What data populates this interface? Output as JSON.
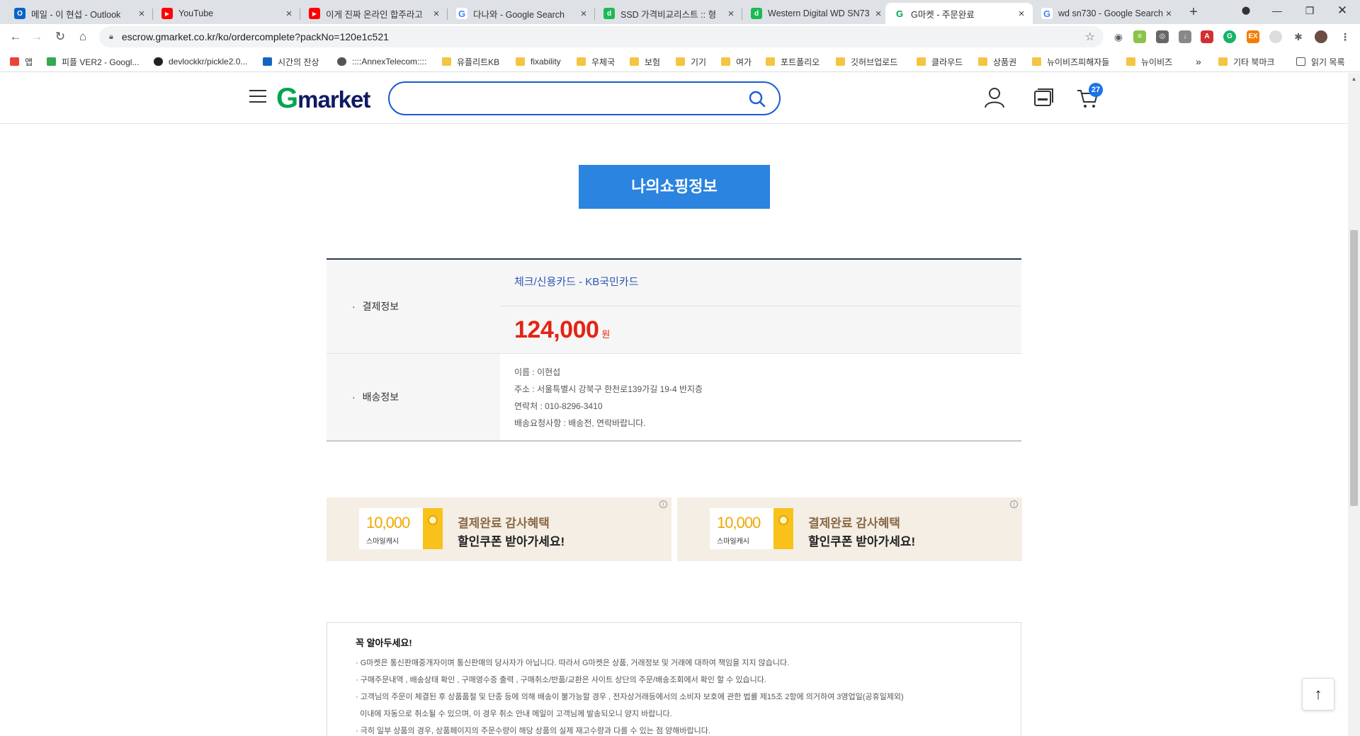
{
  "browser": {
    "tabs": [
      {
        "title": "메일 - 이 현섭 - Outlook",
        "favicon_color": "#0a64c8",
        "favicon_glyph": "O"
      },
      {
        "title": "YouTube",
        "favicon_color": "#ff0000",
        "favicon_glyph": "▶"
      },
      {
        "title": "이게 진짜 온라인 합주라고",
        "favicon_color": "#ff0000",
        "favicon_glyph": "▶"
      },
      {
        "title": "다나와 - Google Search",
        "favicon_color": "#4285f4",
        "favicon_glyph": "G"
      },
      {
        "title": "SSD 가격비교리스트 :: 형",
        "favicon_color": "#1db954",
        "favicon_glyph": "d"
      },
      {
        "title": "Western Digital WD SN73",
        "favicon_color": "#1db954",
        "favicon_glyph": "d"
      },
      {
        "title": "G마켓 - 주문완료",
        "favicon_color": "#00a650",
        "favicon_glyph": "G"
      },
      {
        "title": "wd sn730 - Google Search",
        "favicon_color": "#4285f4",
        "favicon_glyph": "G"
      }
    ],
    "active_tab_index": 6,
    "url": "escrow.gmarket.co.kr/ko/ordercomplete?packNo=120e1c521",
    "bookmarks": [
      {
        "label": "앱",
        "icon": "apps-icon"
      },
      {
        "label": "피플 VER2 - Googl...",
        "icon": "drive-icon"
      },
      {
        "label": "devlockkr/pickle2.0...",
        "icon": "github-icon"
      },
      {
        "label": "시간의 잔상",
        "icon": "link-icon"
      },
      {
        "label": "::::AnnexTelecom::::",
        "icon": "globe-icon"
      },
      {
        "label": "유플리트KB",
        "icon": "folder-icon"
      },
      {
        "label": "fixability",
        "icon": "folder-icon"
      },
      {
        "label": "우체국",
        "icon": "folder-icon"
      },
      {
        "label": "보험",
        "icon": "folder-icon"
      },
      {
        "label": "기기",
        "icon": "folder-icon"
      },
      {
        "label": "여가",
        "icon": "folder-icon"
      },
      {
        "label": "포트폴리오",
        "icon": "folder-icon"
      },
      {
        "label": "깃허브업로드",
        "icon": "folder-icon"
      },
      {
        "label": "클라우드",
        "icon": "folder-icon"
      },
      {
        "label": "상품권",
        "icon": "folder-icon"
      },
      {
        "label": "뉴이비즈피해자들",
        "icon": "folder-icon"
      },
      {
        "label": "뉴이비즈",
        "icon": "folder-icon"
      }
    ],
    "bookmarks_overflow": "»",
    "other_bookmarks": "기타 북마크",
    "reading_list": "읽기 목록"
  },
  "gmarket": {
    "logo_g": "G",
    "logo_rest": "market",
    "search_placeholder": "",
    "cart_count": "27",
    "myshop_button": "나의쇼핑정보",
    "payment": {
      "label": "결제정보",
      "method": "체크/신용카드 - KB국민카드",
      "amount": "124,000",
      "unit": "원"
    },
    "shipping": {
      "label": "배송정보",
      "name": "이름 : 이현섭",
      "address": "주소 : 서울특별시 강북구 한천로139가길 19-4 반지층",
      "phone": "연락처 : 010-8296-3410",
      "request": "배송요청사항 :   배송전, 연락바랍니다."
    },
    "banners": [
      {
        "amount": "10,000",
        "cash_label": "스마일캐시",
        "line1": "결제완료 감사혜택",
        "line2": "할인쿠폰 받아가세요!",
        "info": "i"
      },
      {
        "amount": "10,000",
        "cash_label": "스마일캐시",
        "line1": "결제완료 감사혜택",
        "line2": "할인쿠폰 받아가세요!",
        "info": "i"
      }
    ],
    "notice": {
      "title": "꼭 알아두세요!",
      "lines": [
        "· G마켓은 통신판매중개자이며 통신판매의 당사자가 아닙니다. 따라서 G마켓은 상품, 거래정보 및 거래에 대하여 책임을 지지 않습니다.",
        "· 구매주문내역 , 배송상태 확인 , 구매영수증 출력 , 구매취소/반품/교환은 사이트 상단의 주문/배송조회에서 확인 할 수 있습니다.",
        "· 고객님의 주문이 체결된 후 상품품절 및 단종 등에 의해 배송이 불가능할 경우 , 전자상거래등에서의 소비자 보호에 관한 법률 제15조 2항에 의거하여 3영업일(공휴일제외)",
        "  이내에 자동으로 취소될 수 있으며, 이 경우 취소 안내 메일이 고객님께 발송되오니 양지 바랍니다.",
        "· 극히 일부 상품의 경우, 상품페이지의 주문수량이 해당 상품의 실제 재고수량과 다를 수 있는 점 양해바랍니다."
      ]
    },
    "top_button": "↑"
  },
  "colors": {
    "brand_green": "#00a650",
    "brand_navy": "#0f1b62",
    "search_border": "#1d5bd6",
    "button_blue": "#2a84e0",
    "price_red": "#e32414",
    "badge_blue": "#1a73e8"
  }
}
